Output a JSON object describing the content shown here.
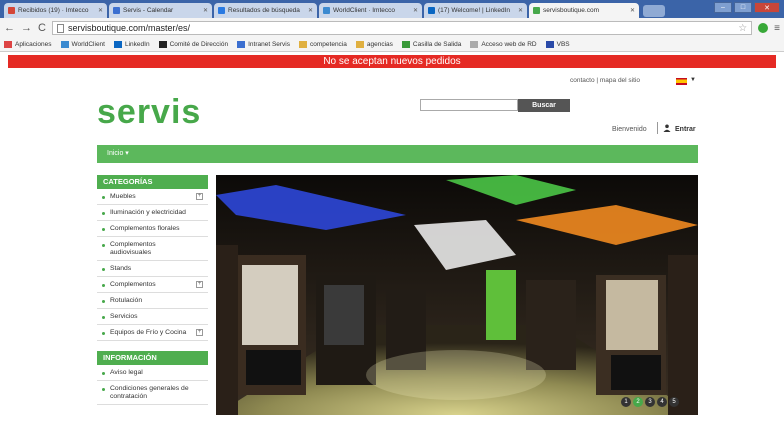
{
  "browser": {
    "tabs": [
      {
        "label": "Recibidos (19) · Imtecco",
        "color": "#d44638",
        "active": false
      },
      {
        "label": "Servis - Calendar",
        "color": "#3b6fd0",
        "active": false
      },
      {
        "label": "Resultados de búsqueda",
        "color": "#2a7ae2",
        "active": false
      },
      {
        "label": "WorldClient · Imtecco",
        "color": "#3b8ad0",
        "active": false
      },
      {
        "label": "(17) Welcome! | LinkedIn",
        "color": "#0a66c2",
        "active": false
      },
      {
        "label": "servisboutique.com",
        "color": "#47a84a",
        "active": true
      }
    ],
    "url": "servisboutique.com/master/es/",
    "bookmarks": [
      "Aplicaciones",
      "WorldClient",
      "LinkedIn",
      "Comité de Dirección",
      "Intranet Servis",
      "competencia",
      "agencias",
      "Casilla de Salida",
      "Acceso web de RD",
      "VBS"
    ]
  },
  "page": {
    "notice": "No se aceptan nuevos pedidos",
    "toplinks": "contacto  |  mapa del sitio",
    "logo": "servis",
    "search_button": "Buscar",
    "welcome": "Bienvenido",
    "login": "Entrar",
    "nav_inicio": "Inicio",
    "categories_title": "CATEGORÍAS",
    "categories": [
      {
        "label": "Muebles",
        "expand": true
      },
      {
        "label": "Iluminación y electricidad",
        "expand": false
      },
      {
        "label": "Complementos florales",
        "expand": false
      },
      {
        "label": "Complementos audiovisuales",
        "expand": false
      },
      {
        "label": "Stands",
        "expand": false
      },
      {
        "label": "Complementos",
        "expand": true
      },
      {
        "label": "Rotulación",
        "expand": false
      },
      {
        "label": "Servicios",
        "expand": false
      },
      {
        "label": "Equipos de Frío y Cocina",
        "expand": true
      }
    ],
    "info_title": "INFORMACIÓN",
    "info_items": [
      "Aviso legal",
      "Condiciones generales de contratación"
    ],
    "slider_dots": [
      "1",
      "2",
      "3",
      "4",
      "5"
    ],
    "slider_active": 2,
    "colors": {
      "brand_green": "#47a84a",
      "notice_red": "#e52a24"
    }
  }
}
